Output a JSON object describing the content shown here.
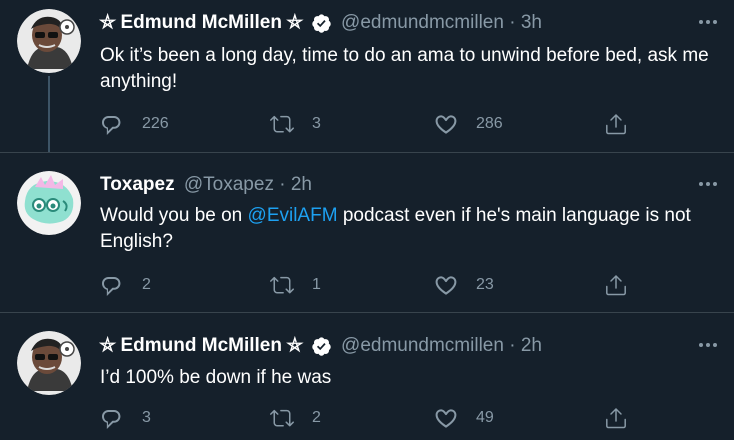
{
  "tweets": [
    {
      "author_name": "⛦ Edmund McMillen ⛦",
      "handle": "@edmundmcmillen",
      "separator": "·",
      "time": "3h",
      "text": "Ok it’s been a long day, time to do an ama to unwind before bed, ask me anything!",
      "replies": "226",
      "retweets": "3",
      "likes": "286"
    },
    {
      "author_name": "Toxapez",
      "handle": "@Toxapez",
      "separator": "·",
      "time": "2h",
      "text_before": "Would you be on ",
      "mention": "@EvilAFM",
      "text_after": " podcast even if he's main language is not English?",
      "replies": "2",
      "retweets": "1",
      "likes": "23"
    },
    {
      "author_name": "⛦ Edmund McMillen ⛦",
      "handle": "@edmundmcmillen",
      "separator": "·",
      "time": "2h",
      "text": "I’d 100% be down if he was",
      "replies": "3",
      "retweets": "2",
      "likes": "49"
    }
  ],
  "icons": {
    "reply": "reply-icon",
    "retweet": "retweet-icon",
    "like": "heart-icon",
    "share": "share-icon",
    "more": "more-icon",
    "verified": "verified-badge-icon"
  },
  "colors": {
    "background": "#15202b",
    "text": "#ffffff",
    "secondary": "#8899a6",
    "link": "#1da1f2",
    "divider": "#38444d"
  }
}
